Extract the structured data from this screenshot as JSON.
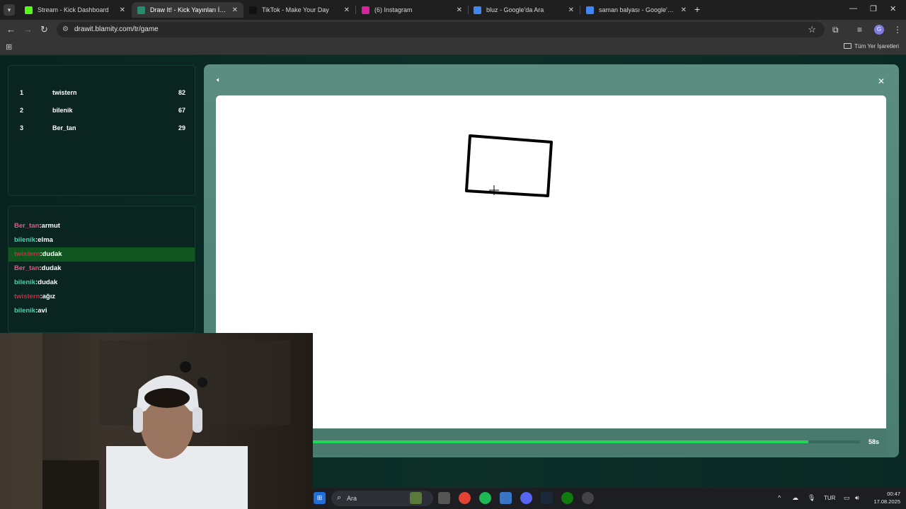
{
  "browser": {
    "tabs": [
      {
        "title": "Stream - Kick Dashboard",
        "favicon": "kick-icon",
        "color": "#53fc18"
      },
      {
        "title": "Draw It! - Kick Yayınları İçin Çizi",
        "favicon": "drawit-icon",
        "color": "#2a8a6e",
        "active": true
      },
      {
        "title": "TikTok - Make Your Day",
        "favicon": "tiktok-icon",
        "color": "#111111"
      },
      {
        "title": "(6) Instagram",
        "favicon": "instagram-icon",
        "color": "#d6249f"
      },
      {
        "title": "bluz - Google'da Ara",
        "favicon": "google-icon",
        "color": "#4285f4"
      },
      {
        "title": "saman balyası - Google'da Ara",
        "favicon": "google-icon",
        "color": "#4285f4"
      }
    ],
    "url": "drawit.blamity.com/tr/game",
    "bookmarks_label": "Tüm Yer İşaretleri",
    "profile_initial": "G"
  },
  "leaderboard": [
    {
      "rank": "1",
      "name": "twistern",
      "score": "82"
    },
    {
      "rank": "2",
      "name": "bilenik",
      "score": "67"
    },
    {
      "rank": "3",
      "name": "Ber_tan",
      "score": "29"
    }
  ],
  "chat": [
    {
      "user": "Ber_tan",
      "msg": "armut",
      "color": "#e8577f"
    },
    {
      "user": "bilenik",
      "msg": "elma",
      "color": "#3dd6b0"
    },
    {
      "user": "twistern",
      "msg": "dudak",
      "color": "#e0203d",
      "highlight": true
    },
    {
      "user": "Ber_tan",
      "msg": "dudak",
      "color": "#e8577f"
    },
    {
      "user": "bilenik",
      "msg": "dudak",
      "color": "#3dd6b0"
    },
    {
      "user": "twistern",
      "msg": "ağız",
      "color": "#e0203d"
    },
    {
      "user": "bilenik",
      "msg": "avi",
      "color": "#3dd6b0"
    }
  ],
  "game": {
    "timer_text": "58s",
    "timer_fraction": 0.92,
    "accent": "#1fd655"
  },
  "taskbar": {
    "search_label": "Ara",
    "language": "TUR",
    "time": "00:47",
    "date": "17.08.2025"
  }
}
